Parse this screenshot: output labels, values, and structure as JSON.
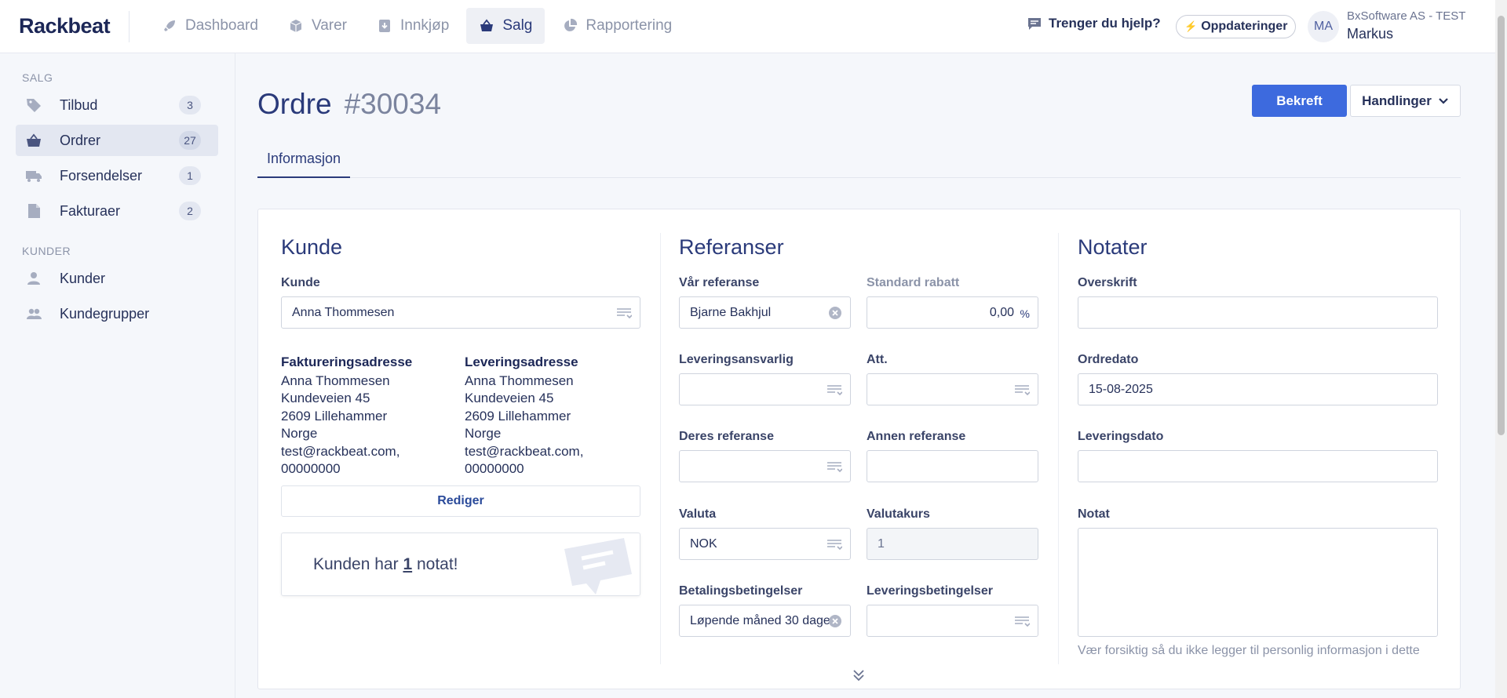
{
  "app": {
    "logo": "Rackbeat"
  },
  "nav": [
    {
      "label": "Dashboard",
      "icon": "rocket-icon"
    },
    {
      "label": "Varer",
      "icon": "box-icon"
    },
    {
      "label": "Innkjøp",
      "icon": "inbox-download-icon"
    },
    {
      "label": "Salg",
      "icon": "basket-icon",
      "active": true
    },
    {
      "label": "Rapportering",
      "icon": "pie-chart-icon"
    }
  ],
  "topbar": {
    "help": "Trenger du hjelp?",
    "updates": "Oppdateringer",
    "avatar_initials": "MA",
    "company": "BxSoftware AS - TEST",
    "user": "Markus"
  },
  "sidebar": {
    "section_sales": "SALG",
    "section_customers": "KUNDER",
    "items": [
      {
        "label": "Tilbud",
        "count": "3",
        "icon": "tag-icon"
      },
      {
        "label": "Ordrer",
        "count": "27",
        "icon": "basket-icon",
        "active": true
      },
      {
        "label": "Forsendelser",
        "count": "1",
        "icon": "truck-icon"
      },
      {
        "label": "Fakturaer",
        "count": "2",
        "icon": "document-icon"
      }
    ],
    "customer_items": [
      {
        "label": "Kunder",
        "icon": "user-icon"
      },
      {
        "label": "Kundegrupper",
        "icon": "users-icon"
      }
    ]
  },
  "page": {
    "title": "Ordre",
    "number": "#30034",
    "confirm_label": "Bekreft",
    "actions_label": "Handlinger",
    "tab": "Informasjon"
  },
  "customer": {
    "title": "Kunde",
    "field_label": "Kunde",
    "field_value": "Anna Thommesen",
    "billing_title": "Faktureringsadresse",
    "billing_lines": [
      "Anna Thommesen",
      "Kundeveien 45",
      "2609 Lillehammer",
      "Norge",
      "test@rackbeat.com,",
      "00000000"
    ],
    "delivery_title": "Leveringsadresse",
    "delivery_lines": [
      "Anna Thommesen",
      "Kundeveien 45",
      "2609 Lillehammer",
      "Norge",
      "test@rackbeat.com,",
      "00000000"
    ],
    "edit_label": "Rediger",
    "note_prefix": "Kunden har",
    "note_count": "1",
    "note_suffix": "notat!"
  },
  "references": {
    "title": "Referanser",
    "our_ref_label": "Vår referanse",
    "our_ref_value": "Bjarne Bakhjul",
    "discount_label": "Standard rabatt",
    "discount_value": "0,00",
    "discount_unit": "%",
    "delivery_resp_label": "Leveringsansvarlig",
    "delivery_resp_value": "",
    "att_label": "Att.",
    "att_value": "",
    "their_ref_label": "Deres referanse",
    "their_ref_value": "",
    "other_ref_label": "Annen referanse",
    "other_ref_value": "",
    "currency_label": "Valuta",
    "currency_value": "NOK",
    "rate_label": "Valutakurs",
    "rate_value": "1",
    "payment_label": "Betalingsbetingelser",
    "payment_value": "Løpende måned 30 dager",
    "delivery_terms_label": "Leveringsbetingelser",
    "delivery_terms_value": ""
  },
  "notes": {
    "title": "Notater",
    "heading_label": "Overskrift",
    "heading_value": "",
    "order_date_label": "Ordredato",
    "order_date_value": "15-08-2025",
    "delivery_date_label": "Leveringsdato",
    "delivery_date_value": "",
    "note_label": "Notat",
    "note_value": "",
    "hint": "Vær forsiktig så du ikke legger til personlig informasjon i dette"
  },
  "colors": {
    "primary": "#3d6ade",
    "navy": "#2a3a7a",
    "muted": "#8b93a8"
  }
}
